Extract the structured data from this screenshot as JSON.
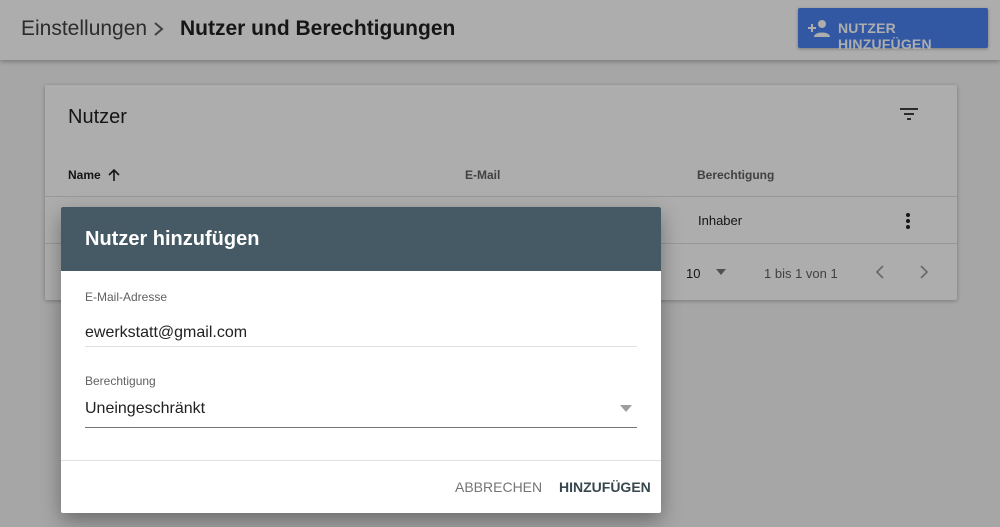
{
  "header": {
    "breadcrumb_root": "Einstellungen",
    "breadcrumb_current": "Nutzer und Berechtigungen",
    "add_user_button": "NUTZER HINZUFÜGEN"
  },
  "users_card": {
    "title": "Nutzer",
    "columns": {
      "name": "Name",
      "email": "E-Mail",
      "permission": "Berechtigung"
    },
    "rows": [
      {
        "permission": "Inhaber"
      }
    ],
    "pagination": {
      "page_size": "10",
      "range": "1 bis 1 von 1"
    }
  },
  "dialog": {
    "title": "Nutzer hinzufügen",
    "email_label": "E-Mail-Adresse",
    "email_value": "ewerkstatt@gmail.com",
    "permission_label": "Berechtigung",
    "permission_value": "Uneingeschränkt",
    "cancel_label": "ABBRECHEN",
    "confirm_label": "HINZUFÜGEN"
  },
  "colors": {
    "primary_button": "#4a82f2",
    "dialog_header": "#455a64",
    "page_background": "#f5f5f5"
  },
  "icons": [
    "chevron-right-icon",
    "person-add-icon",
    "filter-icon",
    "arrow-up-icon",
    "more-vert-icon",
    "dropdown-caret-icon",
    "chevron-left-icon"
  ]
}
